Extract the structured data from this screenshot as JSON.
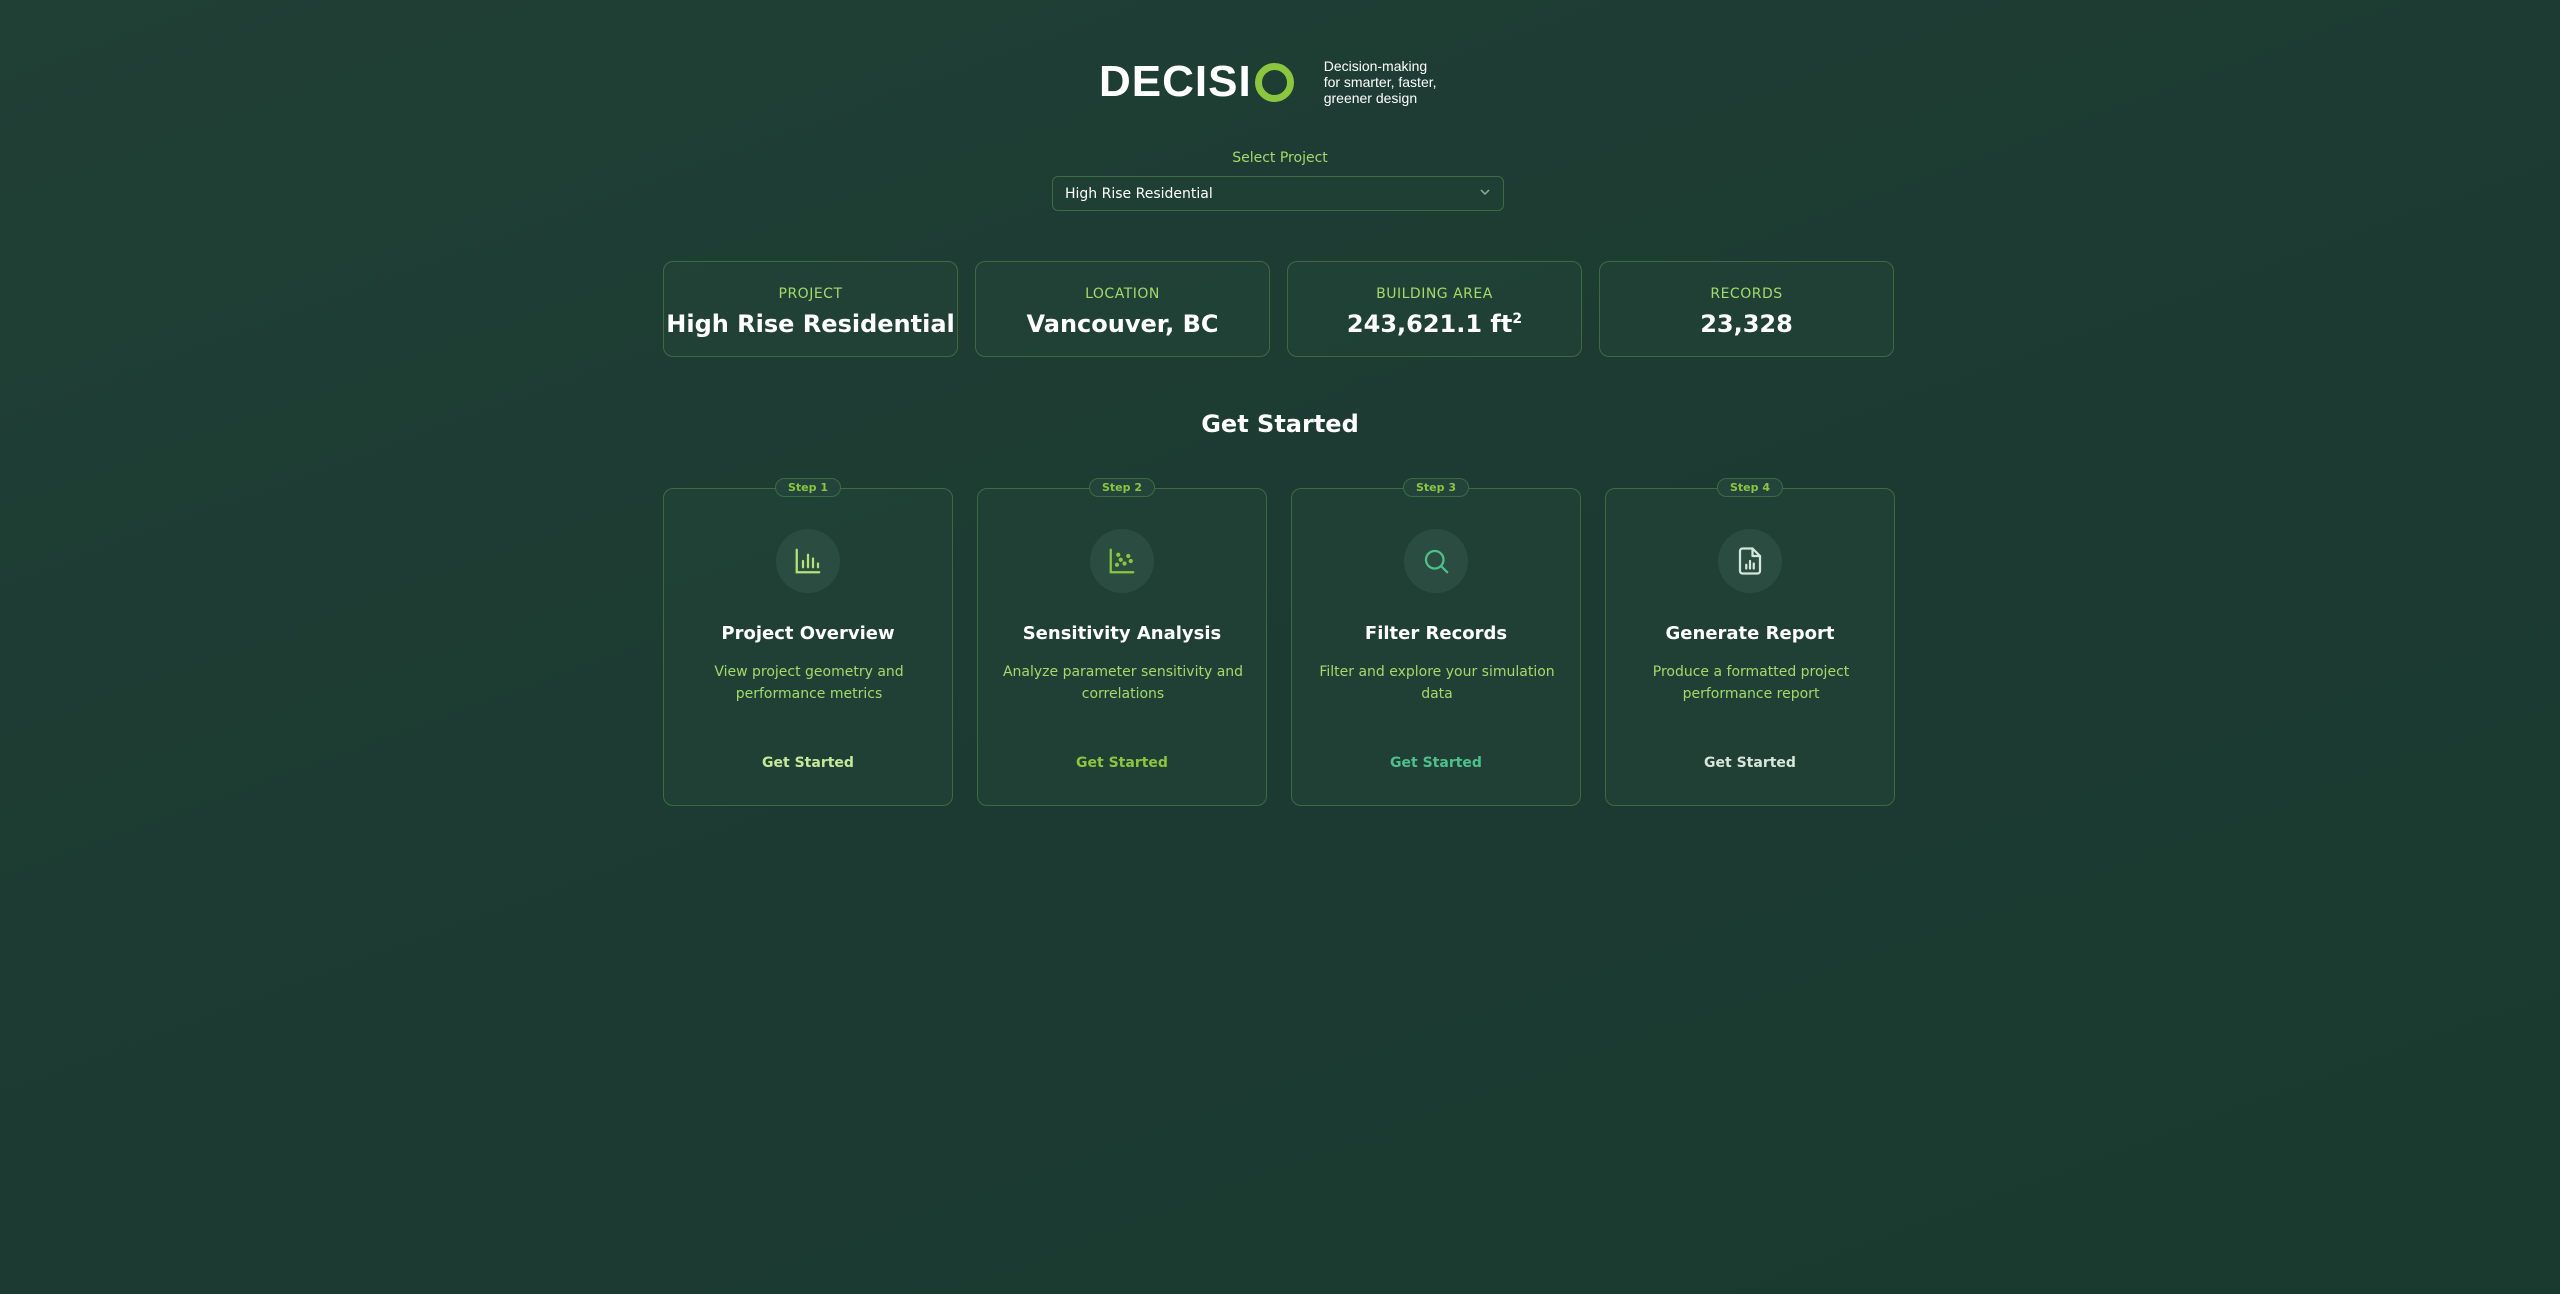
{
  "brand": {
    "name_prefix": "DECISI",
    "tagline_line1": "Decision-making",
    "tagline_line2": "for smarter, faster,",
    "tagline_line3": "greener design",
    "accent_color": "#8cc63f"
  },
  "project_select": {
    "label": "Select Project",
    "value": "High Rise Residential",
    "chevron": "chevron-down-icon"
  },
  "stats": [
    {
      "label": "PROJECT",
      "value": "High Rise Residential"
    },
    {
      "label": "LOCATION",
      "value": "Vancouver, BC"
    },
    {
      "label": "BUILDING AREA",
      "value": "243,621.1 ft",
      "unit_sup": "2"
    },
    {
      "label": "RECORDS",
      "value": "23,328"
    }
  ],
  "get_started": {
    "title": "Get Started",
    "steps": [
      {
        "badge": "Step 1",
        "icon": "bar-chart-icon",
        "title": "Project Overview",
        "desc": "View project geometry and performance metrics",
        "link": "Get Started",
        "link_color": "#c5e89a",
        "icon_color": "#b6e07c"
      },
      {
        "badge": "Step 2",
        "icon": "scatter-chart-icon",
        "title": "Sensitivity Analysis",
        "desc": "Analyze parameter sensitivity and correlations",
        "link": "Get Started",
        "link_color": "#8cc63f",
        "icon_color": "#8cc63f"
      },
      {
        "badge": "Step 3",
        "icon": "search-icon",
        "title": "Filter Records",
        "desc": "Filter and explore your simulation data",
        "link": "Get Started",
        "link_color": "#4fc08d",
        "icon_color": "#4fc08d"
      },
      {
        "badge": "Step 4",
        "icon": "document-chart-icon",
        "title": "Generate Report",
        "desc": "Produce a formatted project performance report",
        "link": "Get Started",
        "link_color": "#d6e6dc",
        "icon_color": "#d6e6dc"
      }
    ]
  }
}
